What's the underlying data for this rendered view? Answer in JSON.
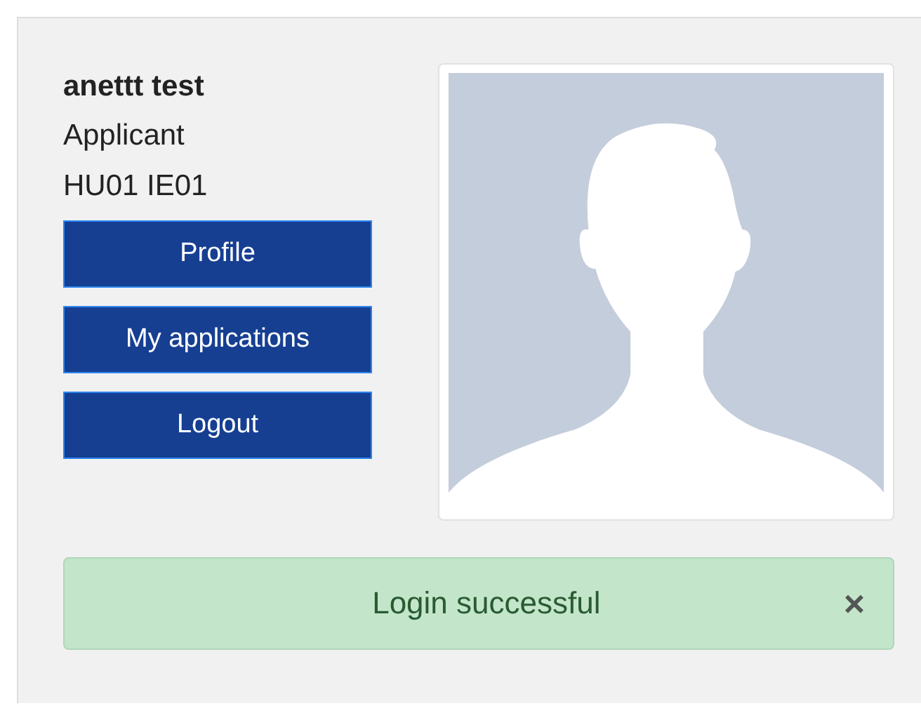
{
  "user": {
    "name": "anettt test",
    "role": "Applicant",
    "code": "HU01 IE01"
  },
  "buttons": [
    {
      "label": "Profile"
    },
    {
      "label": "My applications"
    },
    {
      "label": "Logout"
    }
  ],
  "profile_photo": {
    "kind": "avatar"
  },
  "alert": {
    "message": "Login successful",
    "close": "×"
  }
}
